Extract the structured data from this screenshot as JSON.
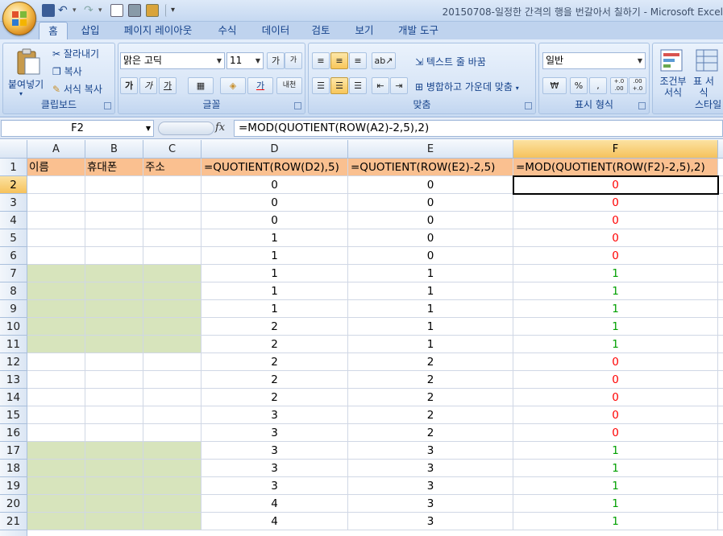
{
  "window": {
    "title": "20150708-일정한 간격의 행을 번갈아서 칠하기 - Microsoft Excel"
  },
  "tabs": [
    "홈",
    "삽입",
    "페이지 레이아웃",
    "수식",
    "데이터",
    "검토",
    "보기",
    "개발 도구"
  ],
  "ribbon": {
    "clipboard": {
      "label": "클립보드",
      "paste": "붙여넣기",
      "cut": "잘라내기",
      "copy": "복사",
      "format_painter": "서식 복사"
    },
    "font": {
      "label": "글꼴",
      "font_name": "맑은 고딕",
      "font_size": "11",
      "bold": "가",
      "italic": "가",
      "underline": "가",
      "grow": "가",
      "shrink": "가",
      "font_color": "가",
      "phonetic": "내천"
    },
    "alignment": {
      "label": "맞춤",
      "wrap_text": "텍스트 줄 바꿈",
      "merge_center": "병합하고 가운데 맞춤"
    },
    "number": {
      "label": "표시 형식",
      "format": "일반",
      "currency": "₩",
      "percent": "%",
      "comma": ",",
      "inc_decimal": "+.0 .00",
      "dec_decimal": ".00 +.0"
    },
    "styles": {
      "label": "스타일",
      "conditional": "조건부 서식",
      "table": "표 서식"
    }
  },
  "formula_bar": {
    "name_box": "F2",
    "fx": "fx",
    "formula": "=MOD(QUOTIENT(ROW(A2)-2,5),2)"
  },
  "columns": [
    "A",
    "B",
    "C",
    "D",
    "E",
    "F"
  ],
  "header_row": [
    "이름",
    "휴대폰",
    "주소",
    "=QUOTIENT(ROW(D2),5)",
    "=QUOTIENT(ROW(E2)-2,5)",
    "=MOD(QUOTIENT(ROW(F2)-2,5),2)"
  ],
  "rows": [
    {
      "n": "2",
      "d": "0",
      "e": "0",
      "f": "0",
      "shade": false
    },
    {
      "n": "3",
      "d": "0",
      "e": "0",
      "f": "0",
      "shade": false
    },
    {
      "n": "4",
      "d": "0",
      "e": "0",
      "f": "0",
      "shade": false
    },
    {
      "n": "5",
      "d": "1",
      "e": "0",
      "f": "0",
      "shade": false
    },
    {
      "n": "6",
      "d": "1",
      "e": "0",
      "f": "0",
      "shade": false
    },
    {
      "n": "7",
      "d": "1",
      "e": "1",
      "f": "1",
      "shade": true
    },
    {
      "n": "8",
      "d": "1",
      "e": "1",
      "f": "1",
      "shade": true
    },
    {
      "n": "9",
      "d": "1",
      "e": "1",
      "f": "1",
      "shade": true
    },
    {
      "n": "10",
      "d": "2",
      "e": "1",
      "f": "1",
      "shade": true
    },
    {
      "n": "11",
      "d": "2",
      "e": "1",
      "f": "1",
      "shade": true
    },
    {
      "n": "12",
      "d": "2",
      "e": "2",
      "f": "0",
      "shade": false
    },
    {
      "n": "13",
      "d": "2",
      "e": "2",
      "f": "0",
      "shade": false
    },
    {
      "n": "14",
      "d": "2",
      "e": "2",
      "f": "0",
      "shade": false
    },
    {
      "n": "15",
      "d": "3",
      "e": "2",
      "f": "0",
      "shade": false
    },
    {
      "n": "16",
      "d": "3",
      "e": "2",
      "f": "0",
      "shade": false
    },
    {
      "n": "17",
      "d": "3",
      "e": "3",
      "f": "1",
      "shade": true
    },
    {
      "n": "18",
      "d": "3",
      "e": "3",
      "f": "1",
      "shade": true
    },
    {
      "n": "19",
      "d": "3",
      "e": "3",
      "f": "1",
      "shade": true
    },
    {
      "n": "20",
      "d": "4",
      "e": "3",
      "f": "1",
      "shade": true
    },
    {
      "n": "21",
      "d": "4",
      "e": "3",
      "f": "1",
      "shade": true
    }
  ],
  "colors": {
    "header_fill": "#fac090",
    "band_fill": "#d7e4bc",
    "zero_text": "#ff0000",
    "one_text": "#00a000"
  }
}
